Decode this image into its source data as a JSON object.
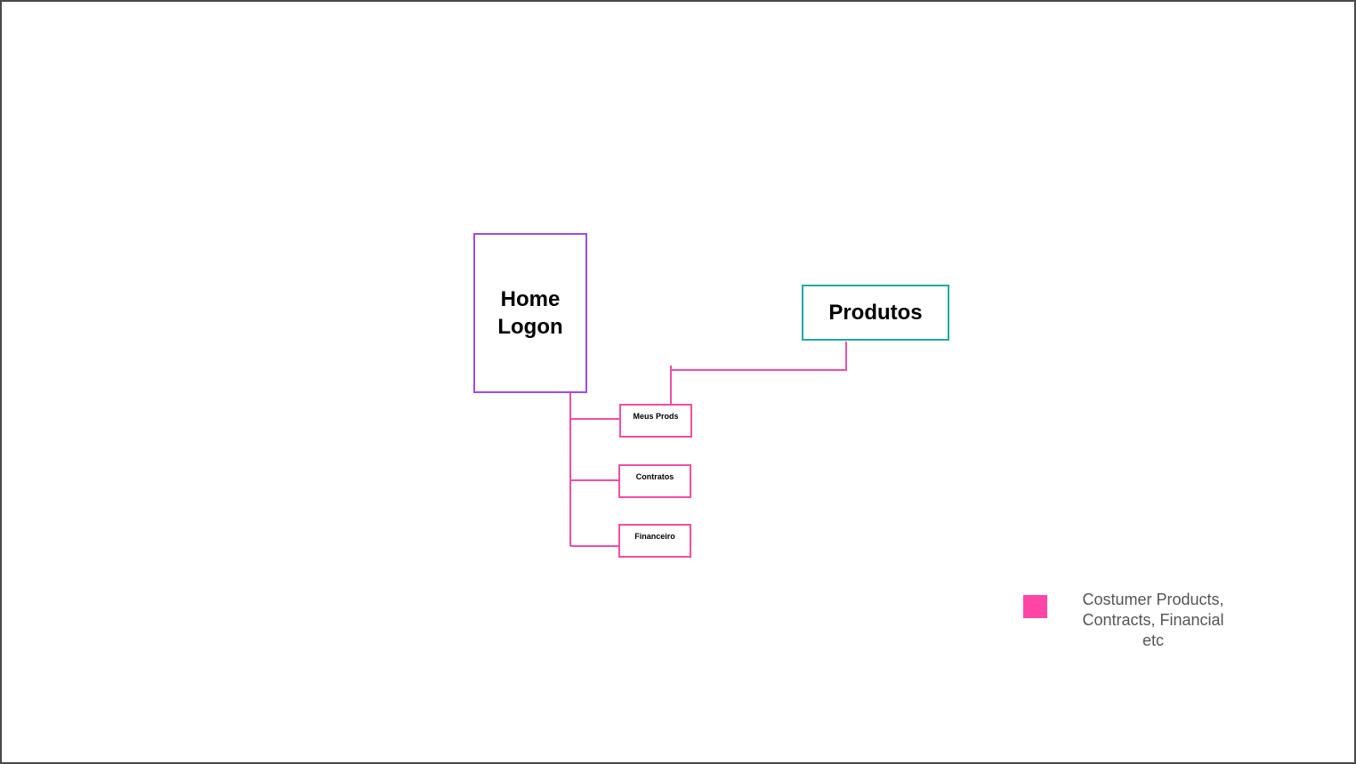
{
  "diagram": {
    "nodes": {
      "home": {
        "line1": "Home",
        "line2": "Logon",
        "border_color": "#9b4dea"
      },
      "produtos": {
        "label": "Produtos",
        "border_color": "#22a8a0"
      },
      "meus_prods": {
        "label": "Meus Prods",
        "border_color": "#ef4fa2"
      },
      "contratos": {
        "label": "Contratos",
        "border_color": "#ef4fa2"
      },
      "financeiro": {
        "label": "Financeiro",
        "border_color": "#ef4fa2"
      }
    },
    "edges": [
      {
        "from": "home",
        "to": "meus_prods"
      },
      {
        "from": "home",
        "to": "contratos"
      },
      {
        "from": "home",
        "to": "financeiro"
      },
      {
        "from": "produtos",
        "to": "meus_prods"
      }
    ],
    "connector_color": "#ef4fa2"
  },
  "legend": {
    "swatch_color": "#ff45a6",
    "line1": "Costumer Products,",
    "line2": "Contracts, Financial",
    "line3": "etc"
  }
}
